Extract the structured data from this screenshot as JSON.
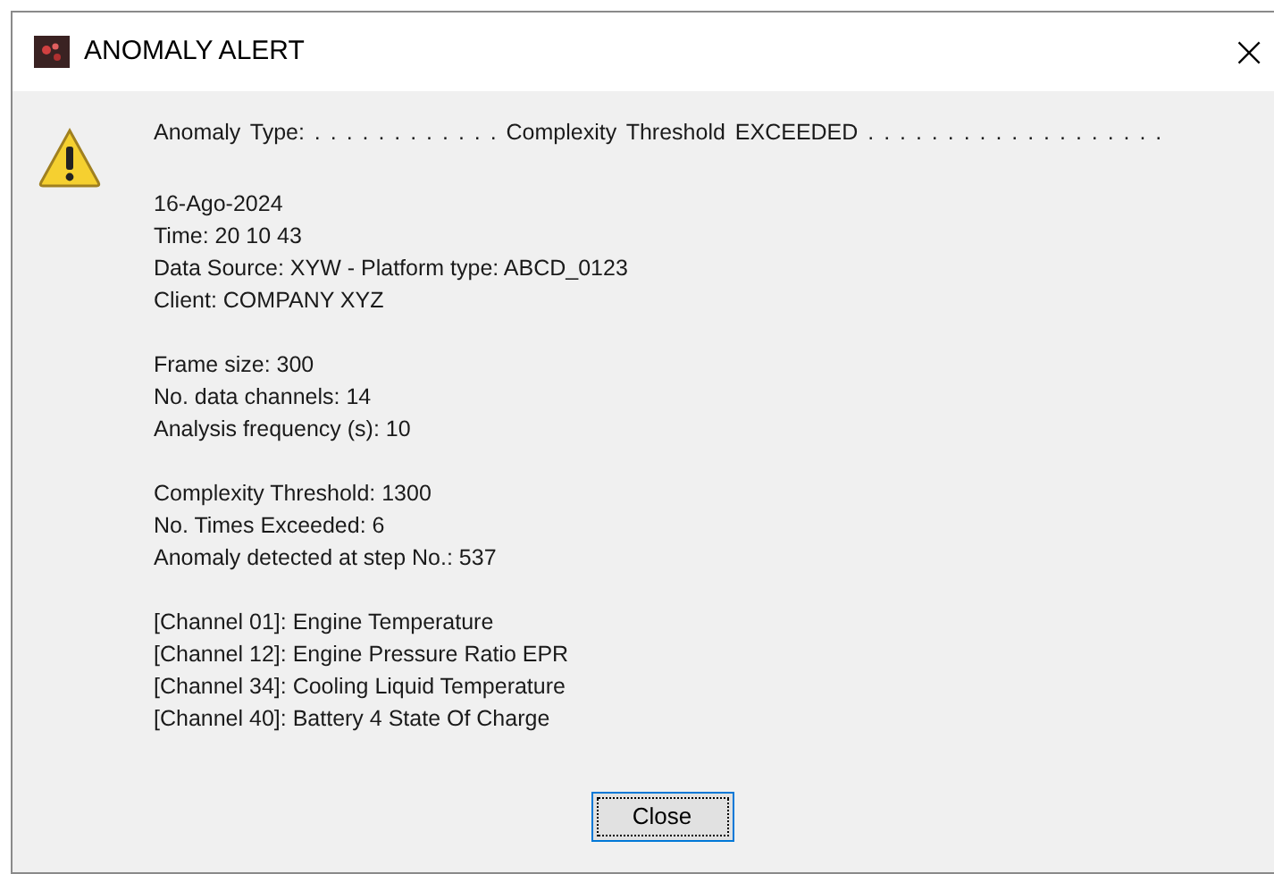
{
  "window": {
    "title": "ANOMALY ALERT",
    "close_glyph": "×"
  },
  "message": {
    "headline": "Anomaly Type: . . . . . . . . . . . . Complexity Threshold EXCEEDED . . . . . . . . . . . . . . . . . . .",
    "groups": [
      [
        "16-Ago-2024",
        "Time: 20 10 43",
        "Data Source: XYW - Platform type: ABCD_0123",
        "Client: COMPANY XYZ"
      ],
      [
        "Frame size: 300",
        "No. data channels: 14",
        "Analysis frequency (s): 10"
      ],
      [
        "Complexity Threshold: 1300",
        "No. Times Exceeded: 6",
        "Anomaly detected at step No.: 537"
      ],
      [
        "[Channel 01]: Engine Temperature",
        "[Channel 12]: Engine Pressure Ratio EPR",
        "[Channel 34]: Cooling Liquid Temperature",
        "[Channel 40]: Battery 4 State Of Charge"
      ]
    ]
  },
  "buttons": [
    {
      "label": "Close",
      "focused": true
    }
  ]
}
